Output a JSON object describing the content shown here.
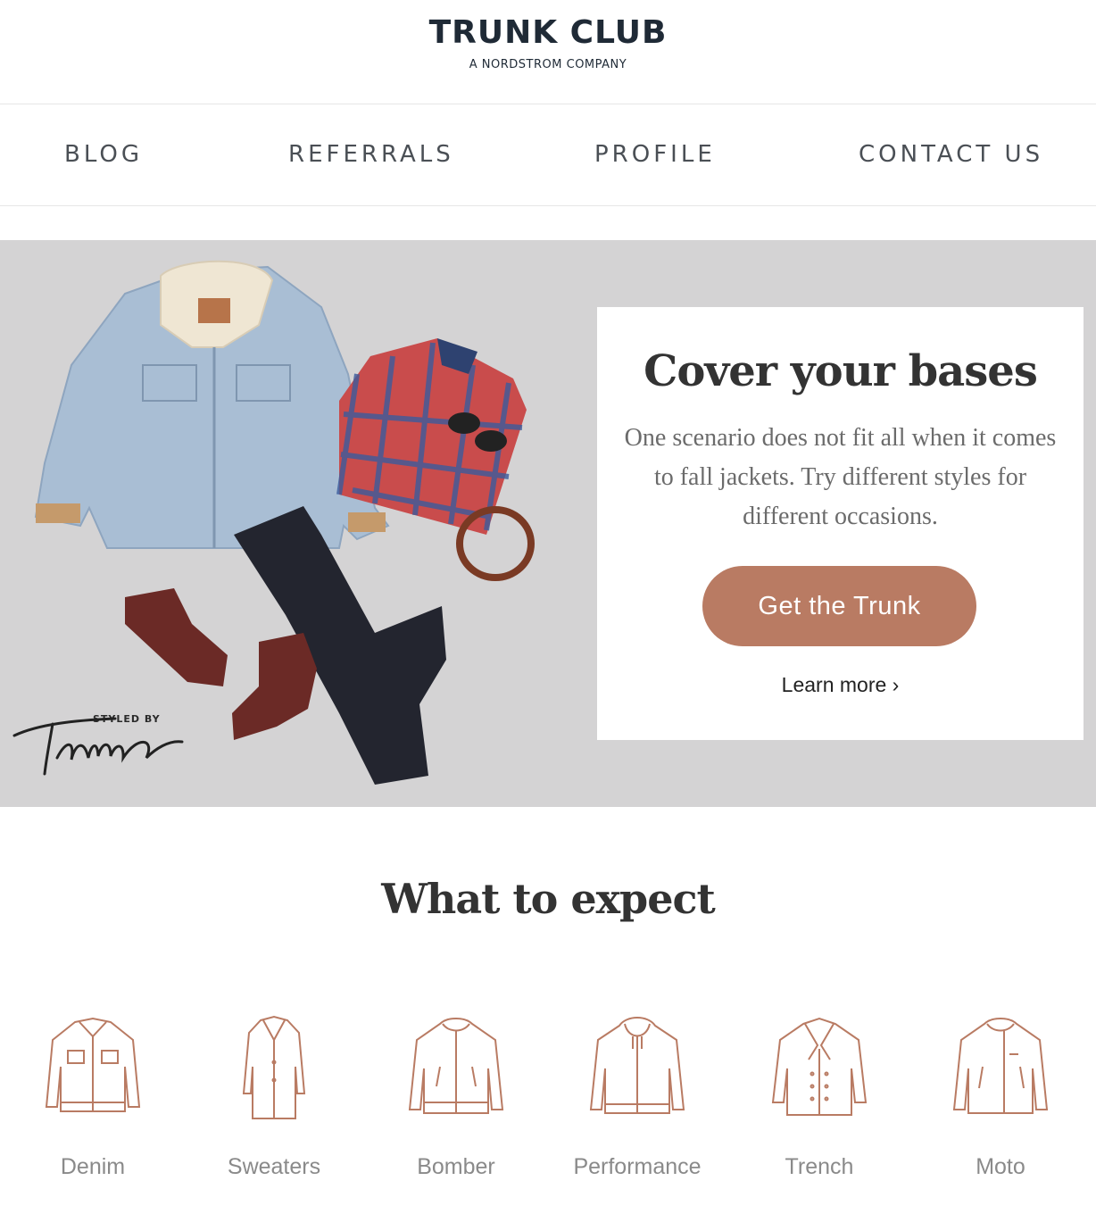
{
  "brand": {
    "name": "TRUNK CLUB",
    "tagline": "A NORDSTROM COMPANY"
  },
  "nav": {
    "items": [
      {
        "label": "BLOG"
      },
      {
        "label": "REFERRALS"
      },
      {
        "label": "PROFILE"
      },
      {
        "label": "CONTACT US"
      }
    ]
  },
  "hero": {
    "title": "Cover your bases",
    "body": "One scenario does not fit all when it comes to fall jackets. Try different styles for different occasions.",
    "cta_label": "Get the Trunk",
    "link_label": "Learn more ›",
    "styled_by_label": "STYLED BY",
    "stylist_signature": "Tamra"
  },
  "expect": {
    "title": "What to expect",
    "categories": [
      {
        "label": "Denim",
        "icon": "denim-jacket-icon"
      },
      {
        "label": "Sweaters",
        "icon": "coat-icon"
      },
      {
        "label": "Bomber",
        "icon": "bomber-jacket-icon"
      },
      {
        "label": "Performance",
        "icon": "hoodie-jacket-icon"
      },
      {
        "label": "Trench",
        "icon": "trench-coat-icon"
      },
      {
        "label": "Moto",
        "icon": "moto-jacket-icon"
      }
    ]
  },
  "colors": {
    "accent": "#b97b63",
    "hero_bg": "#d4d3d4",
    "icon_stroke": "#b97b63",
    "text_dark": "#1f2a36"
  }
}
